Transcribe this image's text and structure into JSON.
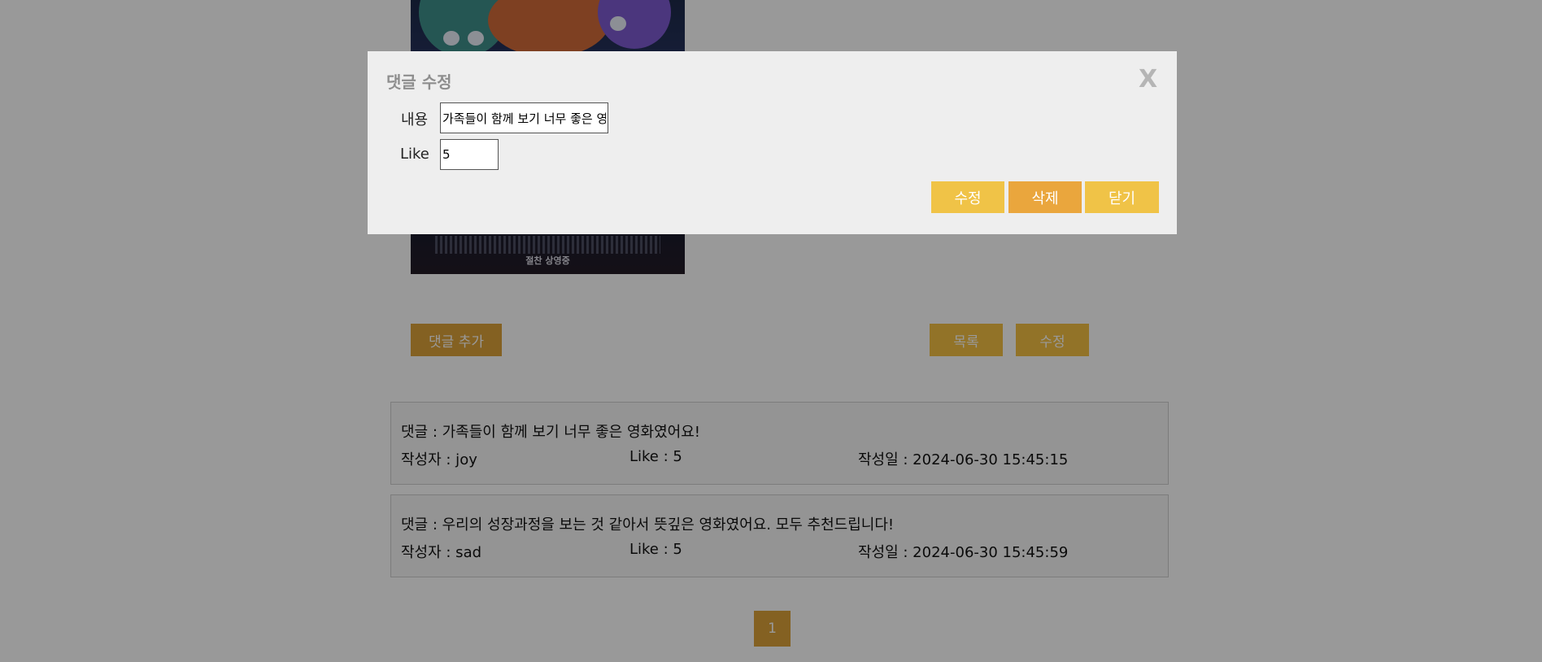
{
  "page": {
    "add_comment_label": "댓글 추가",
    "list_label": "목록",
    "edit_label": "수정",
    "poster_released_text": "절찬 상영중"
  },
  "comments": [
    {
      "text": "댓글 : 가족들이 함께 보기 너무 좋은 영화였어요!",
      "author": "작성자 : joy",
      "like": "Like : 5",
      "date": "작성일 : 2024-06-30 15:45:15"
    },
    {
      "text": "댓글 : 우리의 성장과정을 보는 것 같아서 뜻깊은 영화였어요. 모두 추천드립니다!",
      "author": "작성자 : sad",
      "like": "Like : 5",
      "date": "작성일 : 2024-06-30 15:45:59"
    }
  ],
  "pagination": {
    "current": "1"
  },
  "modal": {
    "title": "댓글 수정",
    "close_label": "X",
    "content_label": "내용",
    "content_value": "가족들이 함께 보기 너무 좋은 영화였어요!",
    "like_label": "Like",
    "like_value": "5",
    "save_label": "수정",
    "delete_label": "삭제",
    "cancel_label": "닫기"
  },
  "colors": {
    "accent": "#f3c044",
    "accent_dark": "#dca23a",
    "delete": "#eaa63d",
    "overlay": "rgba(0,0,0,0.4)",
    "modal_bg": "#eeeeee"
  }
}
